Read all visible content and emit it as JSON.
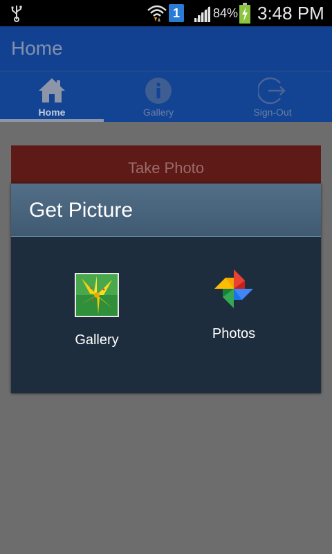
{
  "status_bar": {
    "battery_percent": "84%",
    "time": "3:48 PM",
    "sim_badge": "1",
    "icons": [
      "usb-icon",
      "wifi-icon",
      "sim-icon",
      "signal-icon",
      "battery-charging-icon"
    ]
  },
  "app_bar": {
    "title": "Home"
  },
  "tabs": [
    {
      "label": "Home",
      "icon": "home-icon",
      "selected": true
    },
    {
      "label": "Gallery",
      "icon": "info-icon",
      "selected": false
    },
    {
      "label": "Sign-Out",
      "icon": "sign-out-icon",
      "selected": false
    }
  ],
  "main": {
    "take_photo_label": "Take Photo"
  },
  "dialog": {
    "title": "Get Picture",
    "options": [
      {
        "label": "Gallery",
        "icon": "gallery-app-icon"
      },
      {
        "label": "Photos",
        "icon": "google-photos-icon"
      }
    ]
  },
  "colors": {
    "app_bar": "#124191",
    "tab_bar": "#134393",
    "take_photo": "#5e1a17",
    "dialog_body": "#1e2d3d",
    "dialog_header": "#4a657e",
    "overlay_bg": "#6d6d6d"
  }
}
